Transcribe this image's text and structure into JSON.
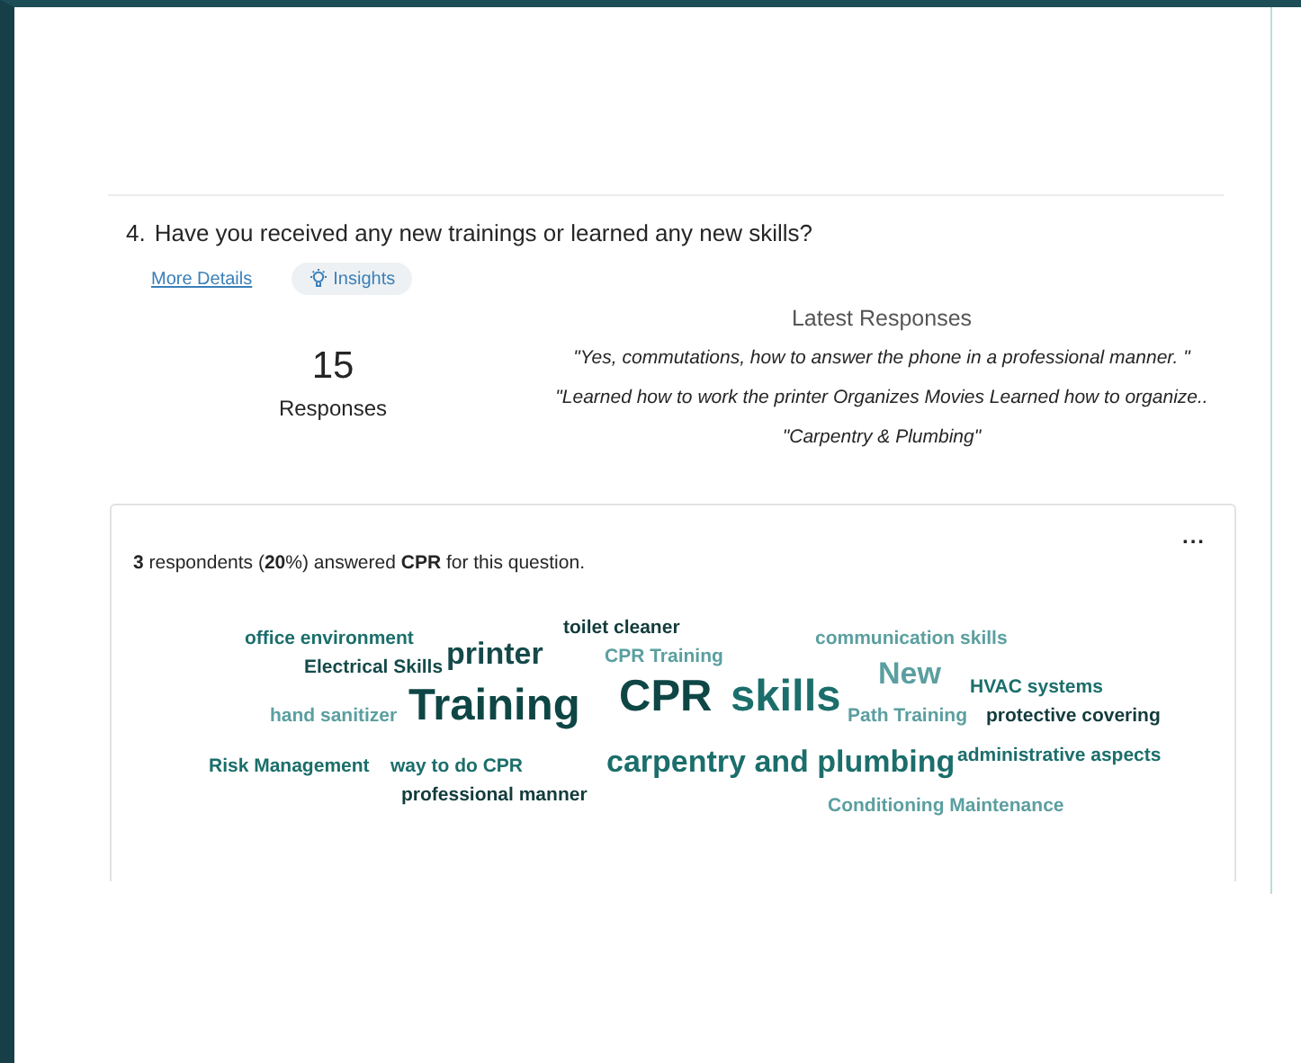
{
  "question": {
    "number": "4.",
    "text": "Have you received any new trainings or learned any new skills?"
  },
  "links": {
    "details": "More Details",
    "insights": "Insights"
  },
  "summary": {
    "count": "15",
    "label": "Responses"
  },
  "latest": {
    "title": "Latest Responses",
    "quotes": [
      "\"Yes, commutations, how to answer the phone in a professional manner. \"",
      "\"Learned how to work the printer Organizes Movies Learned how to organize..",
      "\"Carpentry & Plumbing\""
    ]
  },
  "card": {
    "menu": "...",
    "sentence": "**3** respondents (**20**%) answered **CPR** for this question.",
    "words": [
      {
        "text": "office environment",
        "kind": "s",
        "color": "#1b6e6b"
      },
      {
        "text": "Electrical Skills",
        "kind": "s",
        "color": "#15494a"
      },
      {
        "text": "printer",
        "kind": "m",
        "color": "#15494a"
      },
      {
        "text": "toilet cleaner",
        "kind": "s",
        "color": "#123b3c"
      },
      {
        "text": "CPR Training",
        "kind": "s",
        "color": "#5b9fa0"
      },
      {
        "text": "communication skills",
        "kind": "s",
        "color": "#5b9fa0"
      },
      {
        "text": "New",
        "kind": "m",
        "color": "#5b9fa0"
      },
      {
        "text": "HVAC systems",
        "kind": "s",
        "color": "#1b6e6b"
      },
      {
        "text": "hand sanitizer",
        "kind": "s",
        "color": "#5b9fa0"
      },
      {
        "text": "Training",
        "kind": "l",
        "color": "#0e4645"
      },
      {
        "text": "CPR",
        "kind": "l",
        "color": "#0e4645"
      },
      {
        "text": "skills",
        "kind": "l",
        "color": "#1b6e6b"
      },
      {
        "text": "Path Training",
        "kind": "s",
        "color": "#5b9fa0"
      },
      {
        "text": "protective covering",
        "kind": "s",
        "color": "#123b3c"
      },
      {
        "text": "Risk Management",
        "kind": "s",
        "color": "#1b6e6b"
      },
      {
        "text": "way to do CPR",
        "kind": "s",
        "color": "#1b6e6b"
      },
      {
        "text": "carpentry and plumbing",
        "kind": "m",
        "color": "#1b6e6b"
      },
      {
        "text": "administrative aspects",
        "kind": "s",
        "color": "#1b6e6b"
      },
      {
        "text": "professional manner",
        "kind": "s",
        "color": "#123b3c"
      },
      {
        "text": "Conditioning Maintenance",
        "kind": "s",
        "color": "#5b9fa0"
      }
    ]
  }
}
